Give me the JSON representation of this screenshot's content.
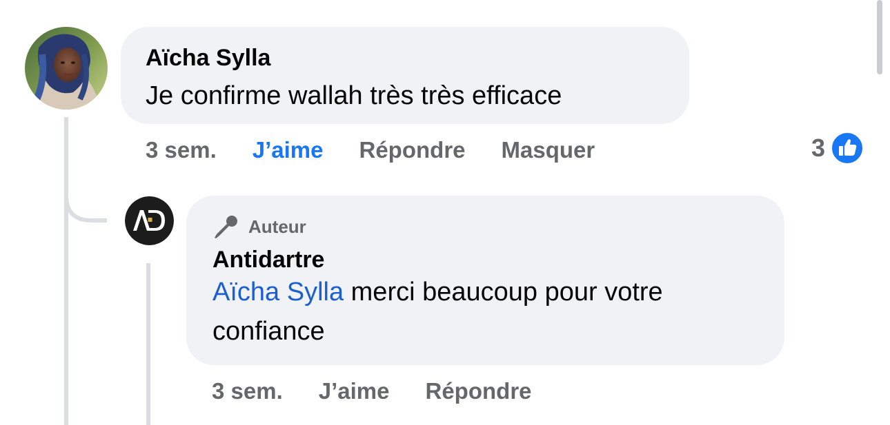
{
  "comments": [
    {
      "author": "Aïcha Sylla",
      "text": "Je confirme wallah très très efficace",
      "time": "3 sem.",
      "like_label": "J’aime",
      "reply_label": "Répondre",
      "hide_label": "Masquer",
      "reaction_count": "3",
      "reaction_icon": "like-icon",
      "liked_by_viewer": true
    }
  ],
  "reply": {
    "badge_icon": "microphone-icon",
    "badge_label": "Auteur",
    "author": "Antidartre",
    "avatar_logo": "AD",
    "mention": "Aïcha Sylla",
    "text_after_mention": " merci beaucoup pour votre confiance",
    "time": "3 sem.",
    "like_label": "J’aime",
    "reply_label": "Répondre"
  },
  "colors": {
    "accent": "#1877f2",
    "mention": "#1b5fcf",
    "muted": "#65676b",
    "bubble": "#f0f2f5",
    "text": "#050505"
  }
}
